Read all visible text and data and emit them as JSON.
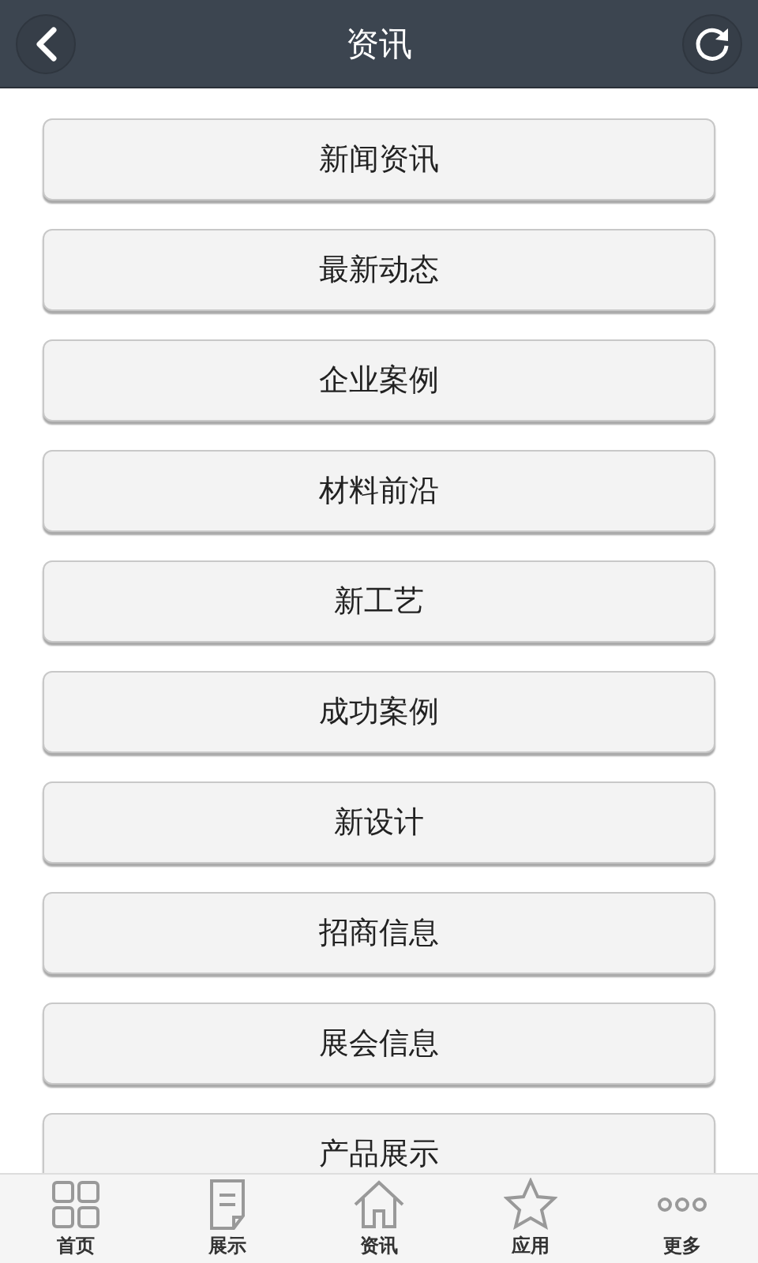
{
  "header": {
    "title": "资讯"
  },
  "menu": [
    {
      "label": "新闻资讯"
    },
    {
      "label": "最新动态"
    },
    {
      "label": "企业案例"
    },
    {
      "label": "材料前沿"
    },
    {
      "label": "新工艺"
    },
    {
      "label": "成功案例"
    },
    {
      "label": "新设计"
    },
    {
      "label": "招商信息"
    },
    {
      "label": "展会信息"
    },
    {
      "label": "产品展示"
    }
  ],
  "tab_bar": [
    {
      "label": "首页"
    },
    {
      "label": "展示"
    },
    {
      "label": "资讯"
    },
    {
      "label": "应用"
    },
    {
      "label": "更多"
    }
  ]
}
